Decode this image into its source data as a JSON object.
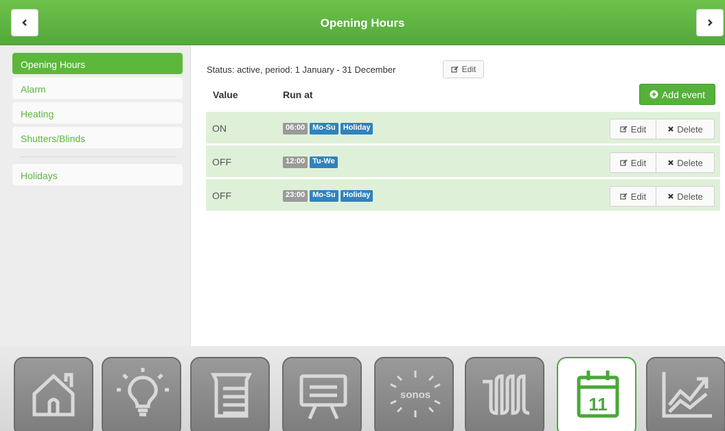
{
  "header": {
    "title": "Opening Hours",
    "back_icon": "chevron-left-icon",
    "forward_icon": "chevron-right-icon",
    "color": "#5bb33f"
  },
  "sidebar": {
    "items": [
      {
        "label": "Opening Hours",
        "active": true
      },
      {
        "label": "Alarm",
        "active": false
      },
      {
        "label": "Heating",
        "active": false
      },
      {
        "label": "Shutters/Blinds",
        "active": false
      }
    ],
    "secondary": [
      {
        "label": "Holidays",
        "active": false
      }
    ]
  },
  "main": {
    "status": "Status: active, period: 1 January - 31 December",
    "status_edit_label": "Edit",
    "columns": {
      "value": "Value",
      "run_at": "Run at"
    },
    "add_event_label": "Add event",
    "events": [
      {
        "value": "ON",
        "time": "06:00",
        "days": [
          "Mo-Su",
          "Holiday"
        ],
        "edit_label": "Edit",
        "delete_label": "Delete"
      },
      {
        "value": "OFF",
        "time": "12:00",
        "days": [
          "Tu-We"
        ],
        "edit_label": "Edit",
        "delete_label": "Delete"
      },
      {
        "value": "OFF",
        "time": "23:00",
        "days": [
          "Mo-Su",
          "Holiday"
        ],
        "edit_label": "Edit",
        "delete_label": "Delete"
      }
    ]
  },
  "dock": {
    "tiles": [
      {
        "icon": "home-icon",
        "active": false
      },
      {
        "icon": "lightbulb-icon",
        "active": false
      },
      {
        "icon": "blinds-icon",
        "active": false
      },
      {
        "icon": "presentation-screen-icon",
        "active": false
      },
      {
        "icon": "sonos-icon",
        "label": "sonos",
        "active": false
      },
      {
        "icon": "heating-radiator-icon",
        "active": false
      },
      {
        "icon": "calendar-icon",
        "label": "11",
        "active": true
      },
      {
        "icon": "chart-trend-icon",
        "active": false
      }
    ]
  }
}
